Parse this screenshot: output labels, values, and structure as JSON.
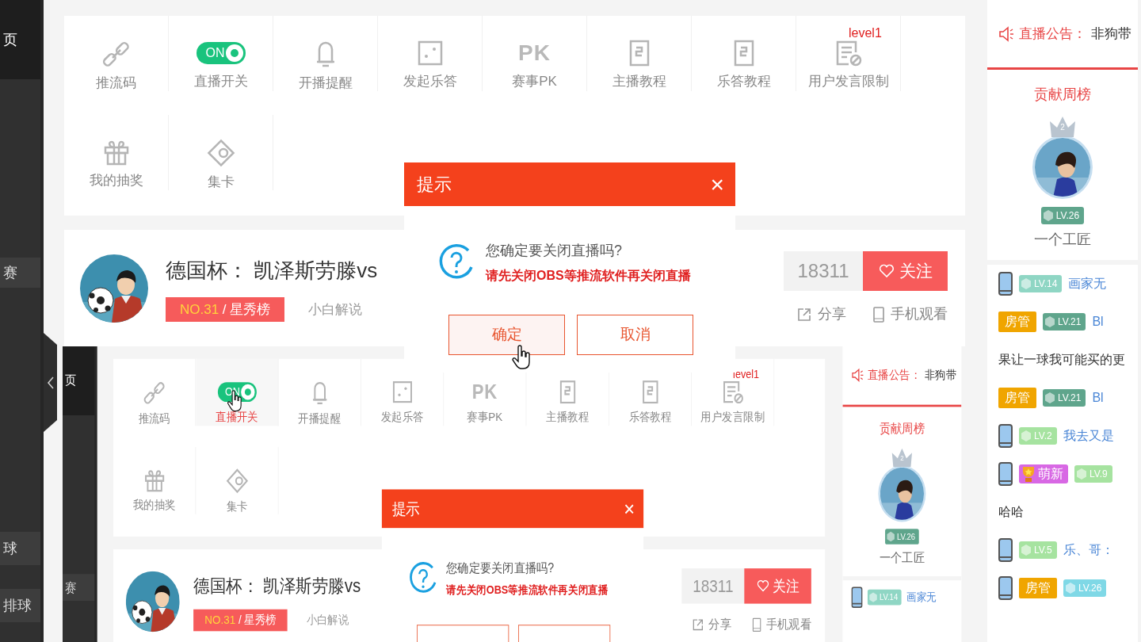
{
  "screen": {
    "sidebar": {
      "items": [
        {
          "label": "页",
          "selected": true
        },
        {
          "label": "赛",
          "selected": false
        },
        {
          "label": "球",
          "selected": false
        },
        {
          "label": "排球",
          "selected": false
        }
      ],
      "collapse_toggle": true
    },
    "toolbar": {
      "level_label": "level1",
      "items": [
        {
          "kind": "link",
          "label": "推流码",
          "hovered": false
        },
        {
          "kind": "switch",
          "label": "直播开关",
          "switch_text": "ON",
          "on": true,
          "hovered": false
        },
        {
          "kind": "bell",
          "label": "开播提醒",
          "hovered": false
        },
        {
          "kind": "dice",
          "label": "发起乐答",
          "hovered": false
        },
        {
          "kind": "pk",
          "label": "赛事PK",
          "icon_text": "PK",
          "hovered": false
        },
        {
          "kind": "doc",
          "label": "主播教程",
          "hovered": false
        },
        {
          "kind": "doc",
          "label": "乐答教程",
          "hovered": false
        },
        {
          "kind": "restrict",
          "label": "用户发言限制",
          "hovered": false
        },
        {
          "kind": "gift",
          "label": "我的抽奖",
          "hovered": false
        },
        {
          "kind": "card",
          "label": "集卡",
          "hovered": false
        }
      ]
    },
    "streamer": {
      "title": "德国杯： 凯泽斯劳滕vs",
      "rank": "NO.31",
      "board": "/ 星秀榜",
      "host": "小白解说",
      "followers": "18311",
      "follow": "关注",
      "share": "分享",
      "mobile": "手机观看"
    },
    "side_panel": {
      "notice_label": "直播公告：",
      "notice": "非狗带",
      "ranking_title": "贡献周榜",
      "top_fan": {
        "rank": "2",
        "level": "LV.26",
        "color": "#5fa58c",
        "name": "一个工匠"
      },
      "chat": [
        {
          "items": [
            {
              "kind": "phone"
            },
            {
              "kind": "level",
              "text": "LV.14",
              "color": "#8fd6c4"
            },
            {
              "kind": "user",
              "text": "画家无"
            }
          ]
        },
        {
          "items": [
            {
              "kind": "admin",
              "text": "房管"
            },
            {
              "kind": "level",
              "text": "LV.21",
              "color": "#5fa58c"
            },
            {
              "kind": "user",
              "text": "Bl"
            }
          ]
        },
        {
          "items": [
            {
              "kind": "message",
              "text": "果让一球我可能买的更"
            }
          ]
        },
        {
          "items": [
            {
              "kind": "admin",
              "text": "房管"
            },
            {
              "kind": "level",
              "text": "LV.21",
              "color": "#5fa58c"
            },
            {
              "kind": "user",
              "text": "Bl"
            }
          ]
        },
        {
          "items": [
            {
              "kind": "phone"
            },
            {
              "kind": "level",
              "text": "LV.2",
              "color": "#a6e3a0"
            },
            {
              "kind": "user",
              "text": "我去又是"
            }
          ]
        },
        {
          "items": [
            {
              "kind": "phone"
            },
            {
              "kind": "newbie",
              "text": "萌新"
            },
            {
              "kind": "level",
              "text": "LV.9",
              "color": "#a6e3a0"
            }
          ]
        },
        {
          "items": [
            {
              "kind": "message",
              "text": "哈哈"
            }
          ]
        },
        {
          "items": [
            {
              "kind": "phone"
            },
            {
              "kind": "level",
              "text": "LV.5",
              "color": "#a6e3a0"
            },
            {
              "kind": "user",
              "text": "乐、哥："
            }
          ]
        },
        {
          "items": [
            {
              "kind": "phone"
            },
            {
              "kind": "admin",
              "text": "房管"
            },
            {
              "kind": "level",
              "text": "LV.26",
              "color": "#7fd8e6"
            }
          ]
        }
      ]
    },
    "dialog": {
      "title": "提示",
      "close": "×",
      "question": "您确定要关闭直播吗?",
      "warning": "请先关闭OBS等推流软件再关闭直播",
      "buttons": [
        {
          "label": "确定",
          "hovered": true
        },
        {
          "label": "取消",
          "hovered": false
        }
      ]
    },
    "nested_screen": {
      "sidebar": {
        "items": [
          {
            "label": "页",
            "selected": true
          },
          {
            "label": "赛",
            "selected": false
          }
        ],
        "collapse_toggle": false
      },
      "toolbar": {
        "level_label": "level1",
        "items": [
          {
            "kind": "link",
            "label": "推流码",
            "hovered": false
          },
          {
            "kind": "switch",
            "label": "直播开关",
            "switch_text": "ON",
            "on": true,
            "hovered": true
          },
          {
            "kind": "bell",
            "label": "开播提醒",
            "hovered": false
          },
          {
            "kind": "dice",
            "label": "发起乐答",
            "hovered": false
          },
          {
            "kind": "pk",
            "label": "赛事PK",
            "icon_text": "PK",
            "hovered": false
          },
          {
            "kind": "doc",
            "label": "主播教程",
            "hovered": false
          },
          {
            "kind": "doc",
            "label": "乐答教程",
            "hovered": false
          },
          {
            "kind": "restrict",
            "label": "用户发言限制",
            "hovered": false
          },
          {
            "kind": "gift",
            "label": "我的抽奖",
            "hovered": false
          },
          {
            "kind": "card",
            "label": "集卡",
            "hovered": false
          }
        ]
      },
      "streamer": {
        "title": "德国杯： 凯泽斯劳滕vs",
        "rank": "NO.31",
        "board": "/ 星秀榜",
        "host": "小白解说",
        "followers": "18311",
        "follow": "关注",
        "share": "分享",
        "mobile": "手机观看"
      },
      "side_panel": {
        "notice_label": "直播公告：",
        "notice": "非狗带",
        "ranking_title": "贡献周榜",
        "top_fan": {
          "rank": "2",
          "level": "LV.26",
          "color": "#5fa58c",
          "name": "一个工匠"
        },
        "chat": [
          {
            "items": [
              {
                "kind": "phone"
              },
              {
                "kind": "level",
                "text": "LV.14",
                "color": "#8fd6c4"
              },
              {
                "kind": "user",
                "text": "画家无"
              }
            ]
          }
        ]
      },
      "dialog": {
        "title": "提示",
        "close": "×",
        "question": "您确定要关闭直播吗?",
        "warning": "请先关闭OBS等推流软件再关闭直播",
        "buttons": [
          {
            "hovered": false
          },
          {
            "hovered": false
          }
        ]
      }
    }
  }
}
